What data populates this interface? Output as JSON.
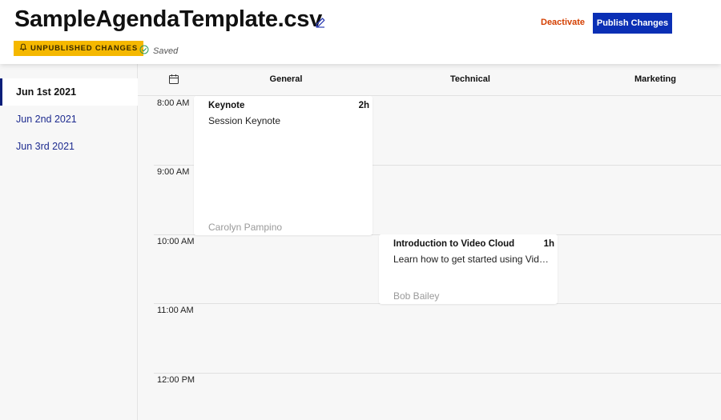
{
  "header": {
    "title": "SampleAgendaTemplate.csv",
    "badge": "UNPUBLISHED CHANGES",
    "status": "Saved",
    "deactivate_label": "Deactivate",
    "publish_label": "Publish Changes"
  },
  "sidebar": {
    "dates": [
      {
        "label": "Jun 1st 2021",
        "active": true
      },
      {
        "label": "Jun 2nd 2021",
        "active": false
      },
      {
        "label": "Jun 3rd 2021",
        "active": false
      }
    ]
  },
  "calendar": {
    "columns": [
      "General",
      "Technical",
      "Marketing"
    ],
    "times": [
      "8:00 AM",
      "9:00 AM",
      "10:00 AM",
      "11:00 AM",
      "12:00 PM"
    ],
    "events": [
      {
        "title": "Keynote",
        "duration": "2h",
        "description": "Session Keynote",
        "speaker": "Carolyn Pampino"
      },
      {
        "title": "Introduction to Video Cloud",
        "duration": "1h",
        "description": "Learn how to get started using Video Cloud",
        "speaker": "Bob Bailey"
      }
    ]
  },
  "colors": {
    "badge": "#f5b800",
    "publish": "#0a2fb5",
    "deactivate": "#d43f00",
    "active_indicator": "#0a1f7a"
  }
}
